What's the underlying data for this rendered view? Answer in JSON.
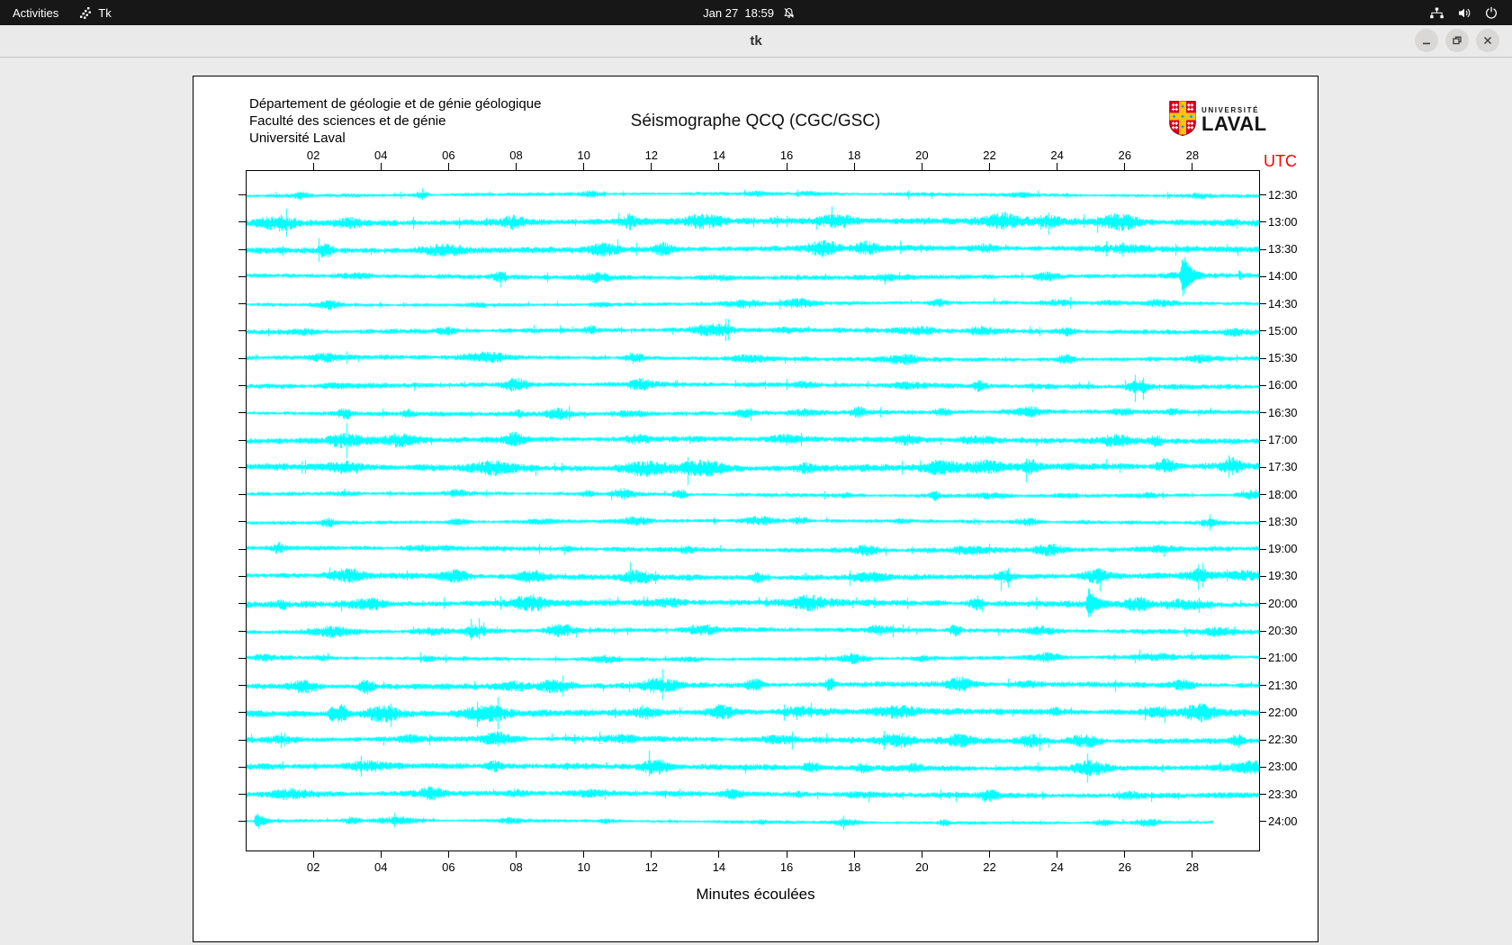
{
  "topbar": {
    "activities": "Activities",
    "app_name": "Tk",
    "clock": "Jan 27  18:59",
    "icons": [
      "tk-app-icon",
      "notifications-muted-icon",
      "network-icon",
      "volume-icon",
      "power-icon"
    ]
  },
  "titlebar": {
    "title": "tk",
    "buttons": [
      "minimize",
      "maximize",
      "close"
    ]
  },
  "header": {
    "dept_lines": [
      "Département de géologie et de génie géologique",
      "Faculté des sciences et de génie",
      "Université Laval"
    ],
    "title": "Séismographe QCQ (CGC/GSC)",
    "logo": {
      "line1": "UNIVERSITÉ",
      "line2": "LAVAL"
    }
  },
  "seismogram": {
    "utc_label": "UTC",
    "utc_color": "#ff0000",
    "xlabel": "Minutes écoulées",
    "trace_color": "#00ffff",
    "x_ticks": [
      "02",
      "04",
      "06",
      "08",
      "10",
      "12",
      "14",
      "16",
      "18",
      "20",
      "22",
      "24",
      "26",
      "28"
    ],
    "row_labels": [
      "12:30",
      "13:00",
      "13:30",
      "14:00",
      "14:30",
      "15:00",
      "15:30",
      "16:00",
      "16:30",
      "17:00",
      "17:30",
      "18:00",
      "18:30",
      "19:00",
      "19:30",
      "20:00",
      "20:30",
      "21:00",
      "21:30",
      "22:00",
      "22:30",
      "23:00",
      "23:30",
      "24:00"
    ],
    "minutes_per_row": 30,
    "last_row_end_minute": 28.6,
    "seed": 987654,
    "events": [
      {
        "row": 3,
        "minute": 27.7,
        "amplitude": 24
      },
      {
        "row": 15,
        "minute": 24.9,
        "amplitude": 16
      },
      {
        "row": 19,
        "minute": 2.5,
        "amplitude": 7
      },
      {
        "row": 23,
        "minute": 0.3,
        "amplitude": 10
      }
    ]
  }
}
